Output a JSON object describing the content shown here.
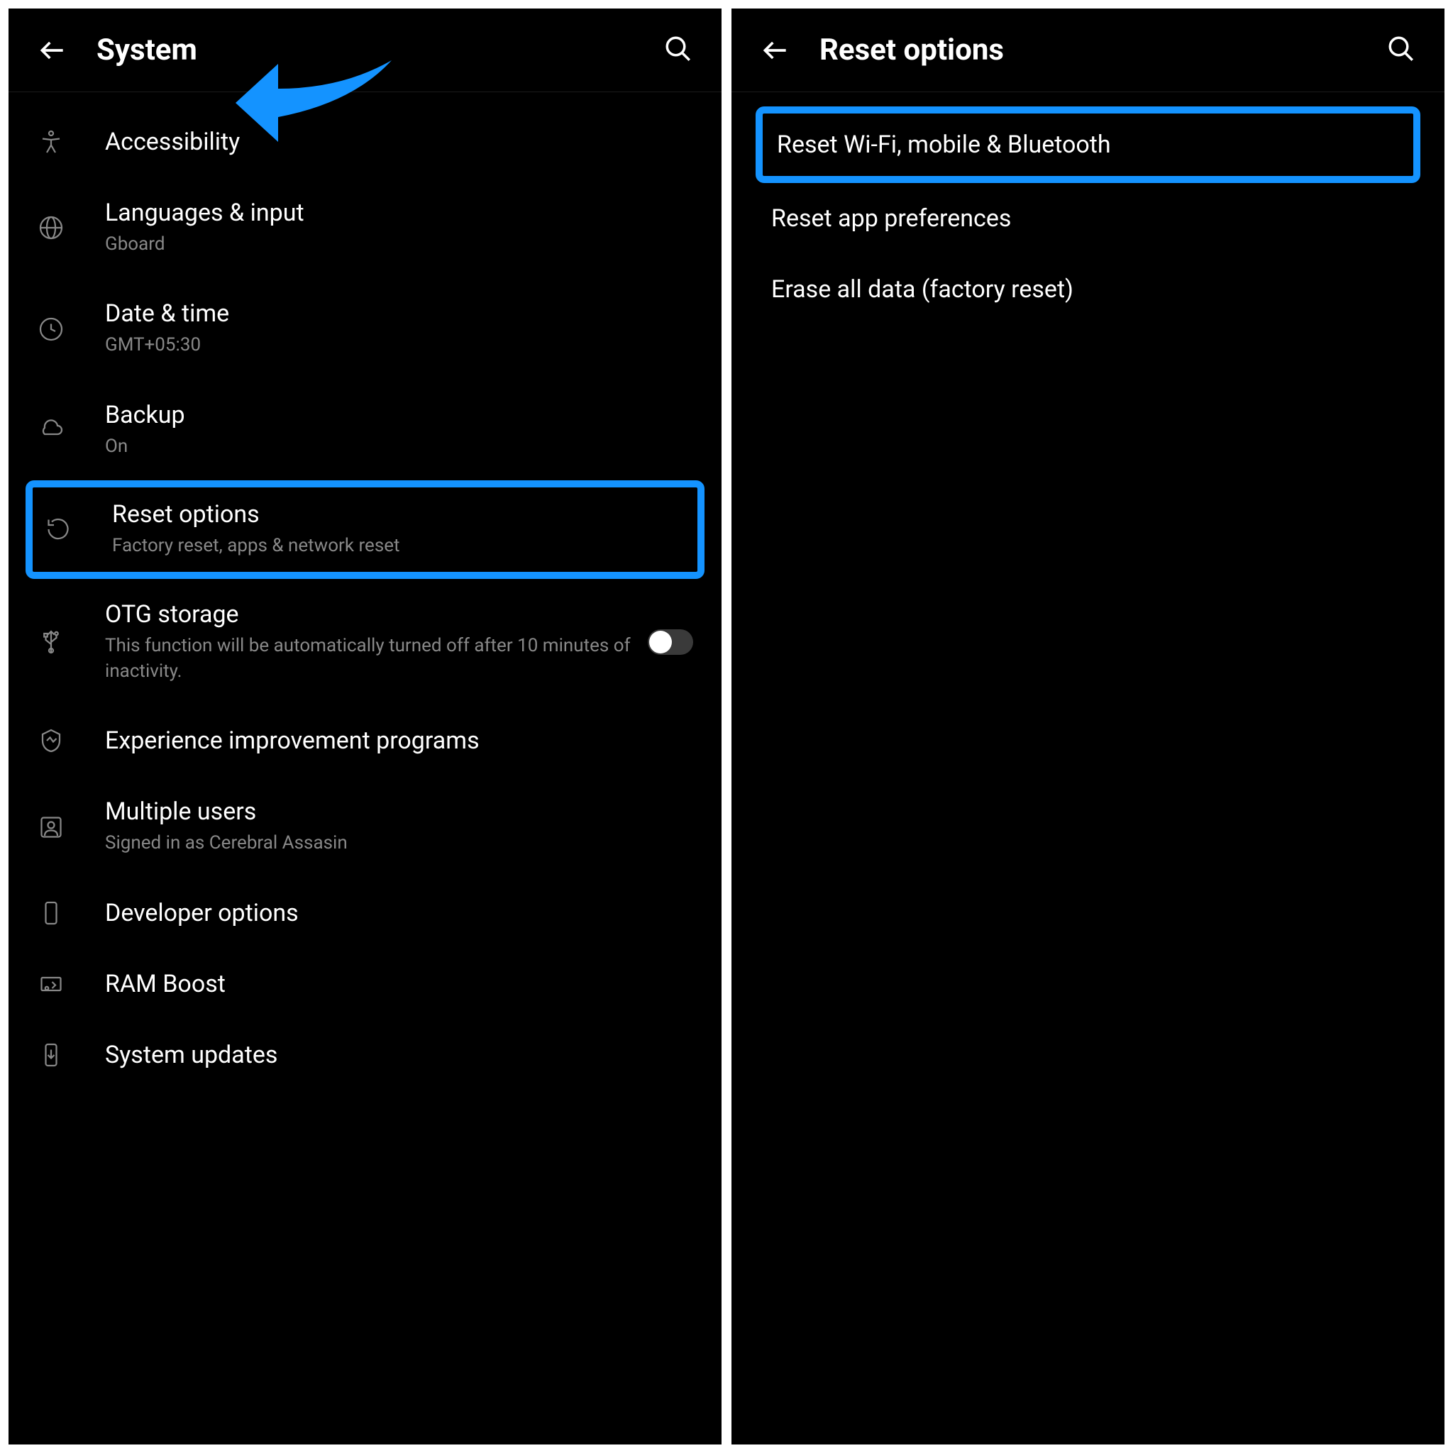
{
  "left": {
    "header": {
      "title": "System"
    },
    "items": [
      {
        "icon": "accessibility",
        "title": "Accessibility",
        "subtitle": null
      },
      {
        "icon": "globe",
        "title": "Languages & input",
        "subtitle": "Gboard"
      },
      {
        "icon": "clock",
        "title": "Date & time",
        "subtitle": "GMT+05:30"
      },
      {
        "icon": "cloud",
        "title": "Backup",
        "subtitle": "On"
      },
      {
        "icon": "reset",
        "title": "Reset options",
        "subtitle": "Factory reset, apps & network reset",
        "highlighted": true
      },
      {
        "icon": "usb",
        "title": "OTG storage",
        "subtitle": "This function will be automatically turned off after 10 minutes of inactivity.",
        "toggle": true
      },
      {
        "icon": "shield",
        "title": "Experience improvement programs",
        "subtitle": null
      },
      {
        "icon": "user",
        "title": "Multiple users",
        "subtitle": "Signed in as Cerebral Assasin"
      },
      {
        "icon": "phone",
        "title": "Developer options",
        "subtitle": null
      },
      {
        "icon": "ram",
        "title": "RAM Boost",
        "subtitle": null
      },
      {
        "icon": "download",
        "title": "System updates",
        "subtitle": null
      }
    ]
  },
  "right": {
    "header": {
      "title": "Reset options"
    },
    "items": [
      {
        "title": "Reset Wi-Fi, mobile & Bluetooth",
        "highlighted": true
      },
      {
        "title": "Reset app preferences"
      },
      {
        "title": "Erase all data (factory reset)"
      }
    ]
  }
}
